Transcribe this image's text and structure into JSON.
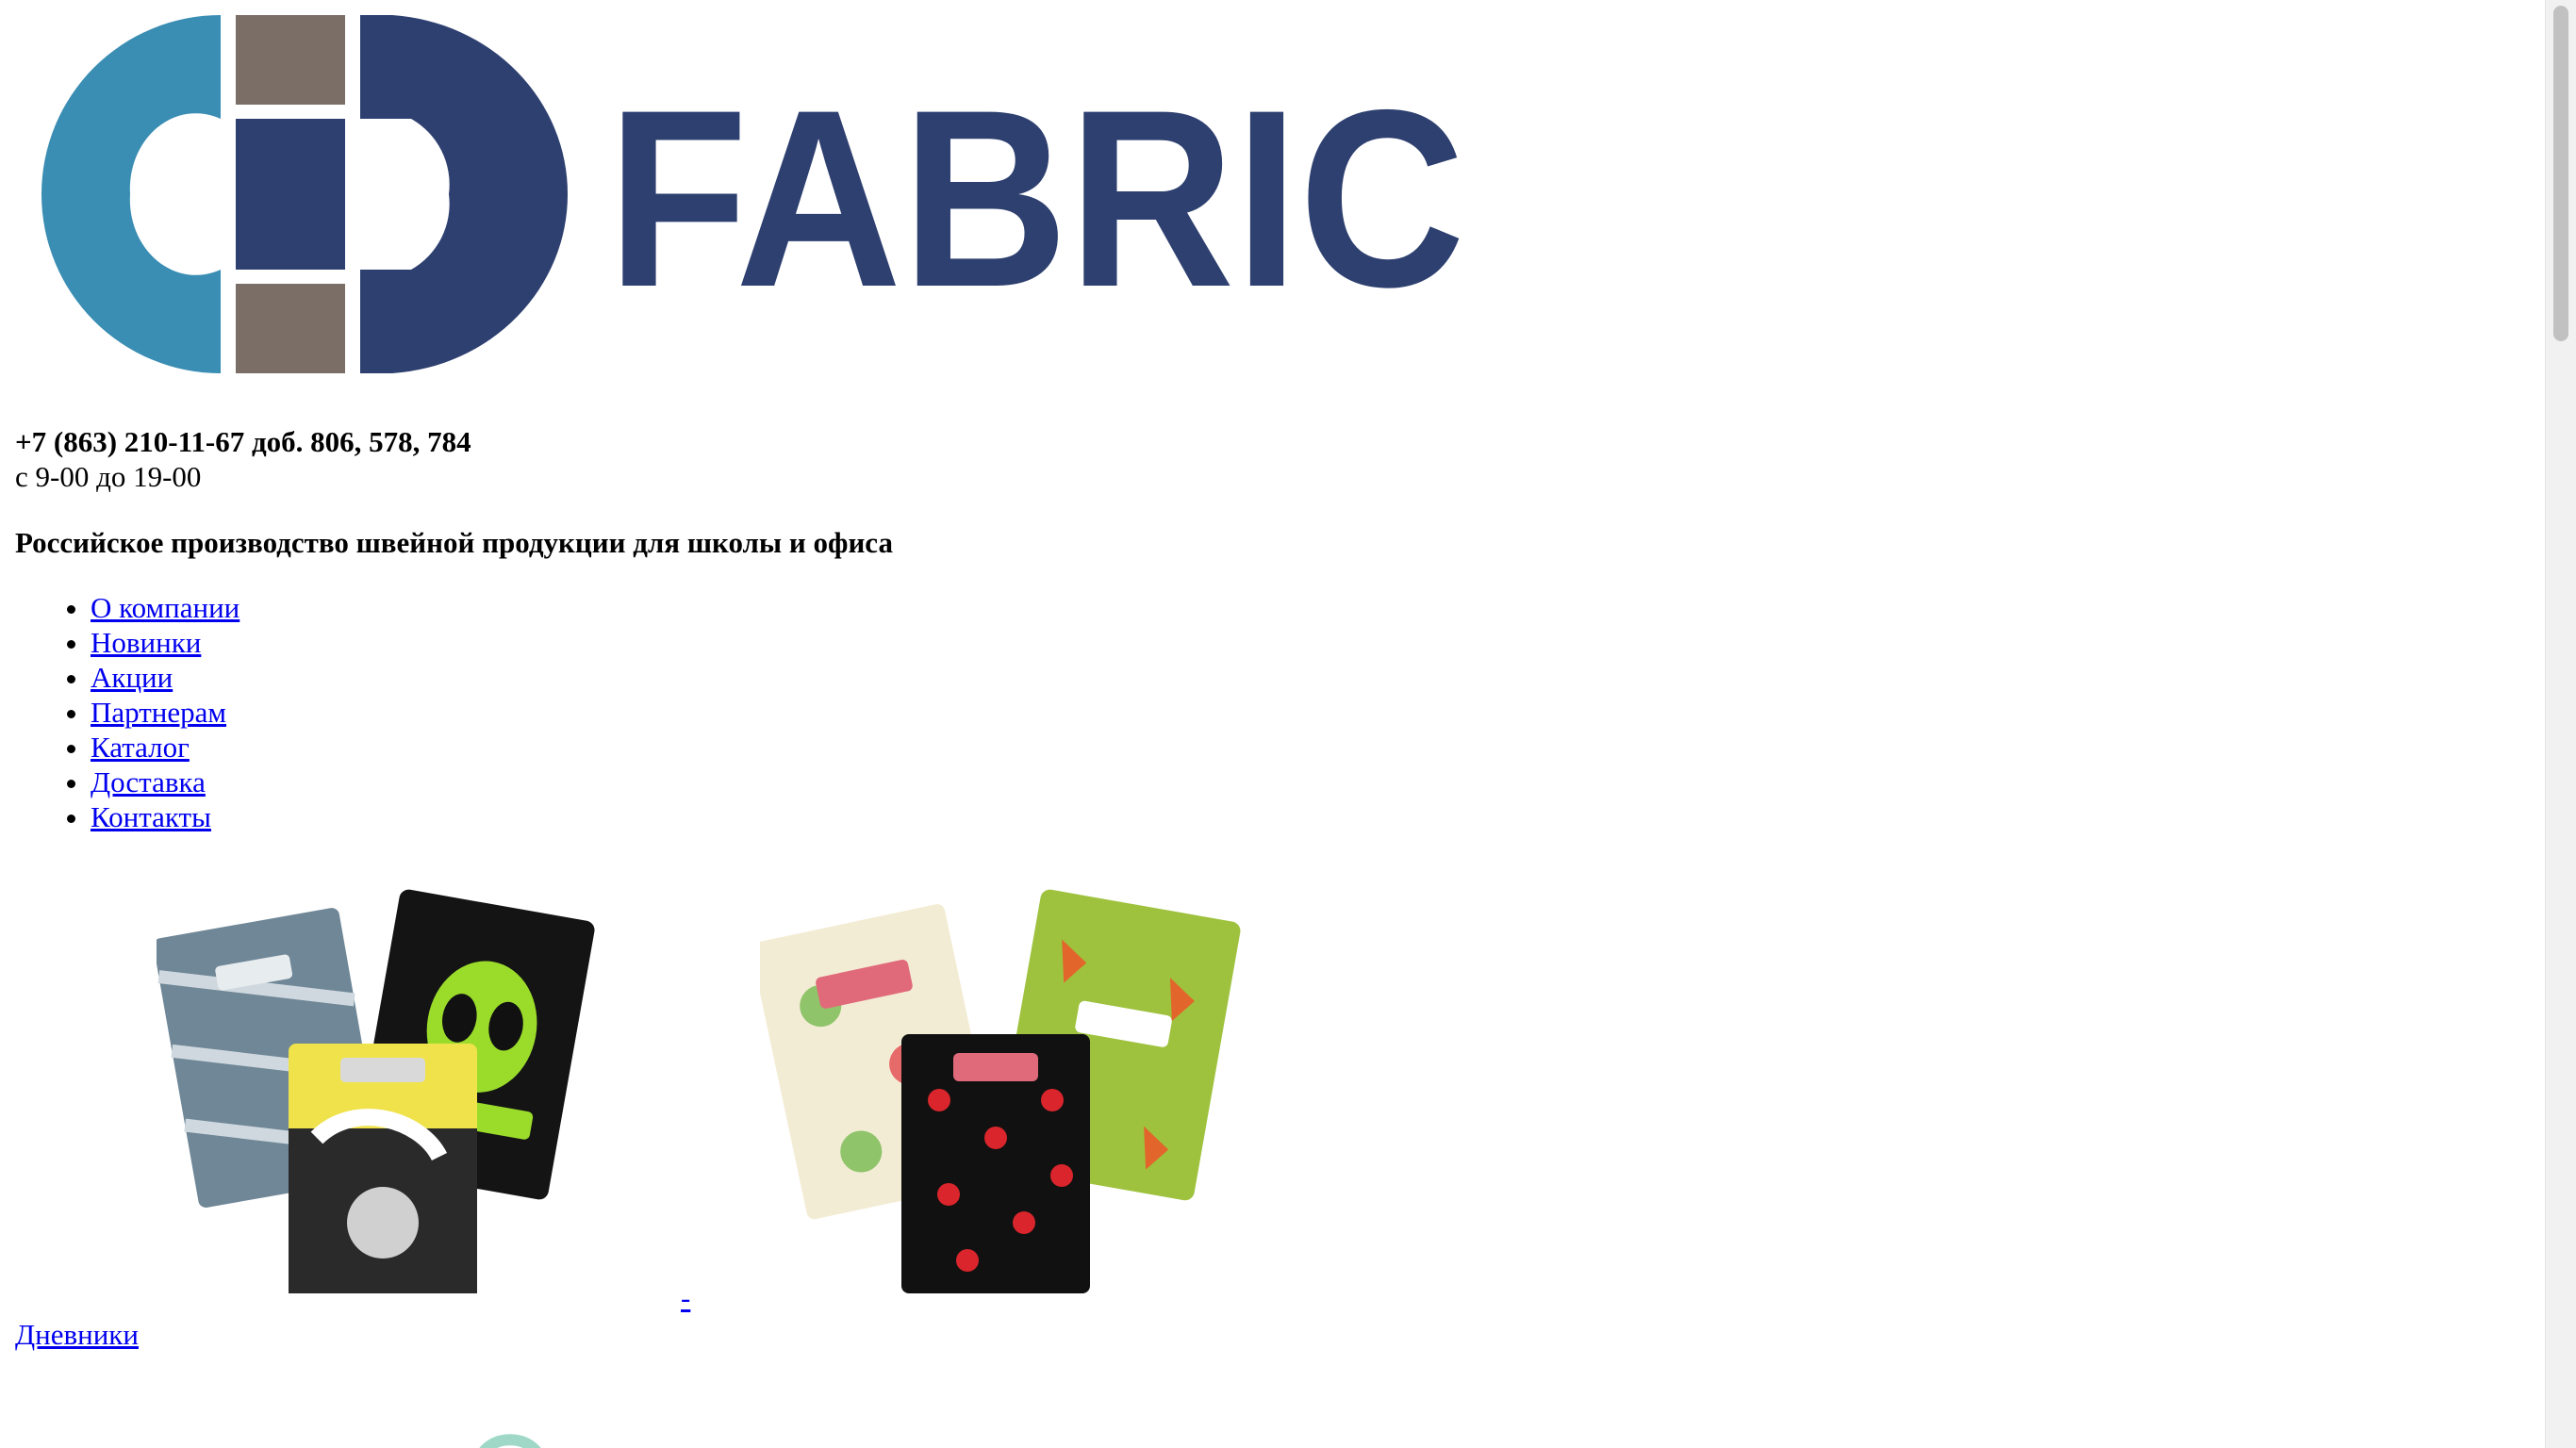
{
  "brand": {
    "logo_text": "FABRIC"
  },
  "contact": {
    "phone": "+7 (863) 210-11-67 доб. 806, 578, 784",
    "hours": "с 9-00 до 19-00"
  },
  "headline": "Российское производство швейной продукции для школы и офиса",
  "menu": {
    "items": [
      {
        "label": "О компании"
      },
      {
        "label": "Новинки"
      },
      {
        "label": "Акции"
      },
      {
        "label": "Партнерам"
      },
      {
        "label": "Каталог"
      },
      {
        "label": "Доставка"
      },
      {
        "label": "Контакты"
      }
    ]
  },
  "catalog": {
    "separator": "-",
    "category_label": "Дневники"
  },
  "colors": {
    "logo_light_blue": "#3a8db3",
    "logo_dark_blue": "#2e4070",
    "logo_gray": "#7a6e66",
    "link": "#0000ee"
  }
}
